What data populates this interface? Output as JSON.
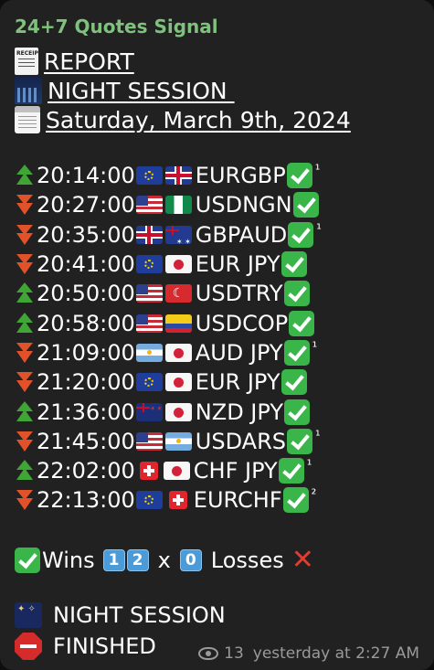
{
  "message": {
    "sender": "24+7 Quotes Signal",
    "report_label": "REPORT",
    "session_label": "NIGHT SESSION ",
    "date_label": "Saturday, March 9th, 2024",
    "signals": [
      {
        "direction": "up",
        "time": "20:14:00",
        "flag1": "eu",
        "flag2": "uk",
        "pair": "EURGBP",
        "mark": "¹"
      },
      {
        "direction": "down",
        "time": "20:27:00",
        "flag1": "us",
        "flag2": "ng",
        "pair": "USDNGN",
        "mark": ""
      },
      {
        "direction": "down",
        "time": "20:35:00",
        "flag1": "uk",
        "flag2": "au",
        "pair": "GBPAUD",
        "mark": "¹"
      },
      {
        "direction": "down",
        "time": "20:41:00",
        "flag1": "eu",
        "flag2": "jp",
        "pair": "EUR JPY",
        "mark": ""
      },
      {
        "direction": "up",
        "time": "20:50:00",
        "flag1": "us",
        "flag2": "tr",
        "pair": "USDTRY",
        "mark": ""
      },
      {
        "direction": "up",
        "time": "20:58:00",
        "flag1": "us",
        "flag2": "co",
        "pair": "USDCOP",
        "mark": ""
      },
      {
        "direction": "down",
        "time": "21:09:00",
        "flag1": "ar",
        "flag2": "jp",
        "pair": "AUD JPY",
        "mark": "¹"
      },
      {
        "direction": "down",
        "time": "21:20:00",
        "flag1": "eu",
        "flag2": "jp",
        "pair": "EUR JPY",
        "mark": ""
      },
      {
        "direction": "up",
        "time": "21:36:00",
        "flag1": "nz",
        "flag2": "jp",
        "pair": "NZD JPY",
        "mark": ""
      },
      {
        "direction": "down",
        "time": "21:45:00",
        "flag1": "us",
        "flag2": "ar",
        "pair": "USDARS",
        "mark": "¹"
      },
      {
        "direction": "up",
        "time": "22:02:00",
        "flag1": "ch",
        "flag2": "jp",
        "pair": "CHF JPY",
        "mark": "¹"
      },
      {
        "direction": "down",
        "time": "22:13:00",
        "flag1": "eu",
        "flag2": "ch",
        "pair": "EURCHF",
        "mark": "²"
      }
    ],
    "summary": {
      "wins_label": "Wins",
      "wins_digits": [
        "1",
        "2"
      ],
      "x_label": "x",
      "losses_digit": "0",
      "losses_label": "Losses"
    },
    "footer": {
      "line1": "NIGHT SESSION",
      "line2": "FINISHED"
    },
    "views": "13",
    "timestamp": "yesterday at 2:27 AM"
  },
  "colors": {
    "sender": "#7ec27d",
    "up_arrow": "#3fa534",
    "down_arrow": "#e2522a",
    "check": "#3ab54a",
    "bubble": "#212121"
  }
}
